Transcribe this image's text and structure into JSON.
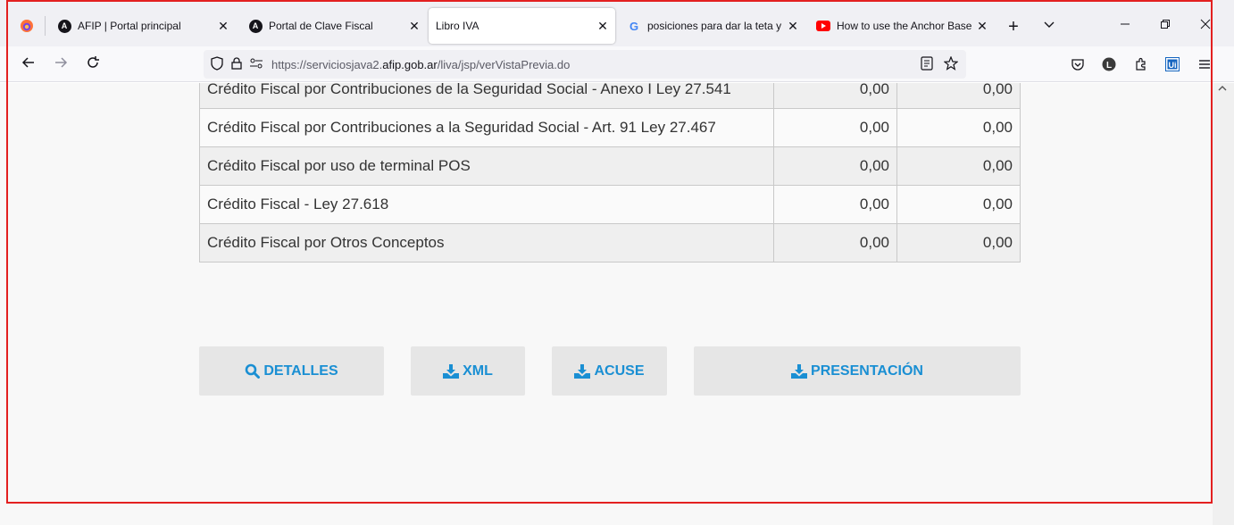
{
  "tabs": [
    {
      "label": "AFIP | Portal principal",
      "icon": "afip-icon"
    },
    {
      "label": "Portal de Clave Fiscal",
      "icon": "afip-icon"
    },
    {
      "label": "Libro IVA",
      "active": true
    },
    {
      "label": "posiciones para dar la teta y q",
      "icon": "google-icon"
    },
    {
      "label": "How to use the Anchor Base /",
      "icon": "youtube-icon"
    }
  ],
  "tab_close": "✕",
  "url": {
    "prefix": "https://serviciosjava2.",
    "domain": "afip.gob.ar",
    "path": "/liva/jsp/verVistaPrevia.do"
  },
  "table_rows": [
    {
      "desc": "Crédito Fiscal por Contribuciones de la Seguridad Social - Anexo I Ley 27.541",
      "v1": "0,00",
      "v2": "0,00"
    },
    {
      "desc": "Crédito Fiscal por Contribuciones a la Seguridad Social - Art. 91 Ley 27.467",
      "v1": "0,00",
      "v2": "0,00"
    },
    {
      "desc": "Crédito Fiscal por uso de terminal POS",
      "v1": "0,00",
      "v2": "0,00"
    },
    {
      "desc": "Crédito Fiscal - Ley 27.618",
      "v1": "0,00",
      "v2": "0,00"
    },
    {
      "desc": "Crédito Fiscal por Otros Conceptos",
      "v1": "0,00",
      "v2": "0,00"
    }
  ],
  "actions": {
    "detalles": "DETALLES",
    "xml": "XML",
    "acuse": "ACUSE",
    "presentacion": "PRESENTACIÓN"
  },
  "colors": {
    "accent": "#1a8fd3",
    "frame": "#e32020"
  }
}
